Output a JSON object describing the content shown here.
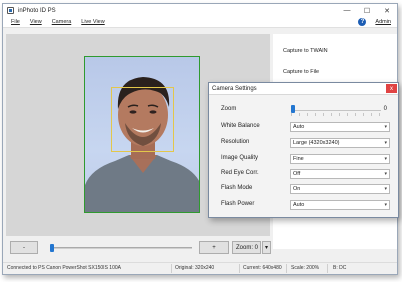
{
  "window": {
    "title": "inPhoto ID PS",
    "controls": {
      "minimize": "—",
      "maximize": "☐",
      "close": "✕"
    }
  },
  "menu": {
    "items": [
      "File",
      "View",
      "Camera",
      "Live View"
    ],
    "help_icon": "?",
    "admin": "Admin"
  },
  "side": {
    "capture_twain": "Capture to TWAIN",
    "capture_file": "Capture to File"
  },
  "bottom": {
    "minus": "-",
    "plus": "+",
    "zoom_label": "Zoom: 0",
    "zoom_dropdown": "▾",
    "zoom_level_fraction": 0.0
  },
  "status": {
    "connection": "Connected to PS Canon PowerShot SX150IS 100A",
    "original": "Original: 320x240",
    "current": "Current: 640x480",
    "scale": "Scale: 200%",
    "mode": "B: DC"
  },
  "dialog": {
    "title": "Camera Settings",
    "close": "x",
    "zoom_label": "Zoom",
    "zoom_value": "0",
    "rows": [
      {
        "label": "White Balance",
        "value": "Auto"
      },
      {
        "label": "Resolution",
        "value": "Large (4320x3240)"
      },
      {
        "label": "Image Quality",
        "value": "Fine"
      },
      {
        "label": "Red Eye Corr.",
        "value": "Off"
      },
      {
        "label": "Flash Mode",
        "value": "On"
      },
      {
        "label": "Flash Power",
        "value": "Auto"
      }
    ]
  },
  "colors": {
    "accent": "#2376d0",
    "photo_frame": "#2f9a2f",
    "face_box": "#e3c74a",
    "close_red": "#e04343"
  }
}
